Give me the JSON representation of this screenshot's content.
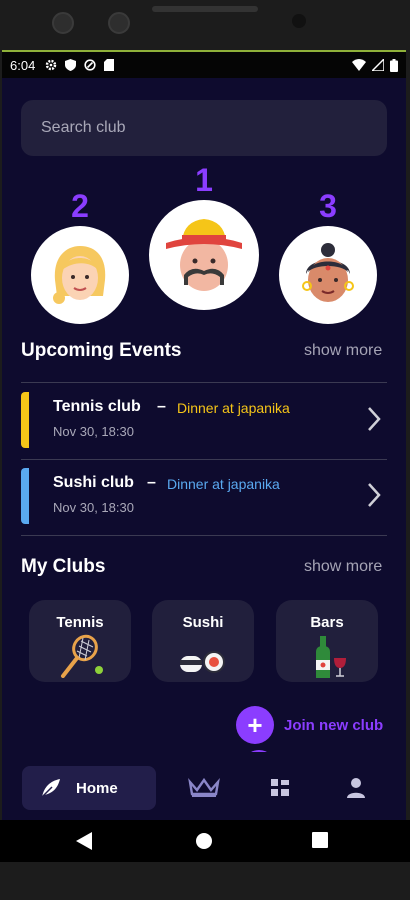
{
  "status": {
    "time": "6:04"
  },
  "search": {
    "placeholder": "Search club"
  },
  "podium": [
    {
      "rank": "2"
    },
    {
      "rank": "1"
    },
    {
      "rank": "3"
    }
  ],
  "upcoming": {
    "title": "Upcoming Events",
    "show_more": "show more",
    "events": [
      {
        "club": "Tennis club",
        "dash": "–",
        "name": "Dinner at japanika",
        "date": "Nov 30, 18:30",
        "color": "#f5c518"
      },
      {
        "club": "Sushi club",
        "dash": "–",
        "name": "Dinner at japanika",
        "date": "Nov 30, 18:30",
        "color": "#5aa9f0"
      }
    ]
  },
  "clubs": {
    "title": "My Clubs",
    "show_more": "show more",
    "items": [
      {
        "name": "Tennis"
      },
      {
        "name": "Sushi"
      },
      {
        "name": "Bars"
      }
    ]
  },
  "join": {
    "label": "Join new club"
  },
  "nav": {
    "home_label": "Home"
  },
  "colors": {
    "accent": "#8b3dff",
    "background": "#0e0b2e",
    "card": "#211f3c"
  }
}
